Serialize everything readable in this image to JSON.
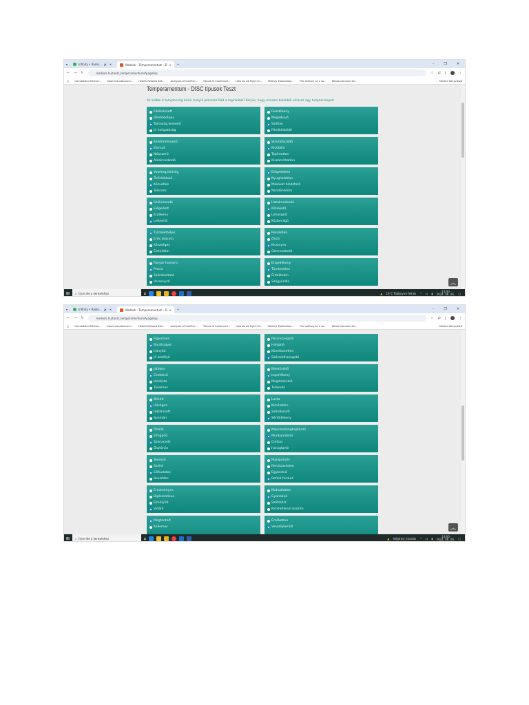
{
  "browser": {
    "tabs": [
      {
        "label": "Infinity • Radio...",
        "active": false
      },
      {
        "label": "Medock - Temperamentum - D",
        "active": true
      }
    ],
    "url": "medock.hu/teszt_temperamentum#pagetop",
    "bookmarks": [
      "Honvédelmi Miniszt...",
      "Good manufacturin...",
      "Health-Related Beh...",
      "Analyses of Confirm...",
      "Trends in Confirmed...",
      "How do we fight CO...",
      "Military Epidemiolo...",
      "The military as a so...",
      "Whole-Genome Se..."
    ],
    "all_bookmarks": "Minden könyvjelző"
  },
  "page": {
    "title": "Temperamentum - DISC típusok Teszt",
    "instruction": "Az alábbi 4 tulajdonság közül melyik jellemző Rád a leginkább? Kérjük, hogy minden blokkból válassz egy tulajdonságot!"
  },
  "taskbar": {
    "search_placeholder": "Írjon ide a kereséshez",
    "time": "14:00",
    "date": "2024. 06. 06."
  },
  "screens": [
    {
      "notification": "16°C Többnyire felhős",
      "rows": [
        [
          [
            [
              "Elkötelezett",
              0
            ],
            [
              "Döntésképes",
              0
            ],
            [
              "Társaság kedvelő",
              1
            ],
            [
              "Jó hallgatóság",
              0
            ]
          ],
          [
            [
              "Feledékeny",
              0
            ],
            [
              "Megalkuvó",
              0
            ],
            [
              "Szótlan",
              1
            ],
            [
              "Főnökösködő",
              0
            ]
          ]
        ],
        [
          [
            [
              "Kezdeményező",
              0
            ],
            [
              "Elemző",
              1
            ],
            [
              "Népszerű",
              0
            ],
            [
              "Alkalmazkodó",
              0
            ]
          ],
          [
            [
              "Visszahúzódó",
              0
            ],
            [
              "Kívülálló",
              1
            ],
            [
              "Tapintatlan",
              0
            ],
            [
              "Kiszámíthatlan",
              0
            ]
          ]
        ],
        [
          [
            [
              "Vezéregyéniség",
              0
            ],
            [
              "Önfeláldozó",
              0
            ],
            [
              "Közvetlen",
              1
            ],
            [
              "Toleráns",
              0
            ]
          ],
          [
            [
              "Elégedetlen",
              1
            ],
            [
              "Nyughatatlan",
              0
            ],
            [
              "Másokat hibáztató",
              0
            ],
            [
              "Nemtörődöm",
              0
            ]
          ]
        ],
        [
          [
            [
              "Szókimondó",
              0
            ],
            [
              "Elégedett",
              0
            ],
            [
              "Érzékeny",
              0
            ],
            [
              "Lelkesítő",
              1
            ]
          ],
          [
            [
              "Hatalmaskodó",
              0
            ],
            [
              "Kötekedő",
              1
            ],
            [
              "Lehangolt",
              0
            ],
            [
              "Közbevágó",
              0
            ]
          ]
        ],
        [
          [
            [
              "Tiszteletteljes",
              1
            ],
            [
              "Erős akaratú",
              0
            ],
            [
              "Készséges",
              0
            ],
            [
              "Életvidám",
              0
            ]
          ],
          [
            [
              "Rendetlen",
              0
            ],
            [
              "Önző",
              0
            ],
            [
              "Kicsinyes",
              1
            ],
            [
              "Gáncsoskodó",
              0
            ]
          ]
        ],
        [
          [
            [
              "Fanyar humorú",
              0
            ],
            [
              "Precíz",
              1
            ],
            [
              "Szórakoztató",
              0
            ],
            [
              "Versenyző",
              0
            ]
          ],
          [
            [
              "Engedékeny",
              0
            ],
            [
              "Türelmetlen",
              1
            ],
            [
              "Érdektelen",
              0
            ],
            [
              "Szégyenlős",
              0
            ]
          ]
        ]
      ]
    },
    {
      "notification": "Időjárási riasztás",
      "rows": [
        [
          [
            [
              "Figyelmes",
              0
            ],
            [
              "Barátságos",
              1
            ],
            [
              "Irányító",
              0
            ],
            [
              "Jó kedélyű",
              0
            ]
          ],
          [
            [
              "Parancsolgató",
              0
            ],
            [
              "Hallgató",
              0
            ],
            [
              "Következetlen",
              0
            ],
            [
              "Szőrszálhasogató",
              1
            ]
          ]
        ],
        [
          [
            [
              "Játékos",
              0
            ],
            [
              "Cselekvő",
              1
            ],
            [
              "Idealista",
              0
            ],
            [
              "Türelmes",
              0
            ]
          ],
          [
            [
              "Beletörődő",
              0
            ],
            [
              "Ingerlékeny",
              1
            ],
            [
              "Magánakvaló",
              0
            ],
            [
              "Tolakodó",
              0
            ]
          ]
        ],
        [
          [
            [
              "Békítő",
              0
            ],
            [
              "Hűséges",
              1
            ],
            [
              "Határozott",
              0
            ],
            [
              "Spontán",
              0
            ]
          ],
          [
            [
              "Lusta",
              0
            ],
            [
              "Kíméletlen",
              0
            ],
            [
              "Szórakozott",
              0
            ],
            [
              "Sértődékeny",
              1
            ]
          ]
        ],
        [
          [
            [
              "Önálló",
              0
            ],
            [
              "Elfogadó",
              0
            ],
            [
              "Szervezett",
              1
            ],
            [
              "Ösztönös",
              0
            ]
          ],
          [
            [
              "Népszerűséghajhászó",
              0
            ],
            [
              "Munkamániás",
              1
            ],
            [
              "Cinikus",
              0
            ],
            [
              "Haragtartó",
              0
            ]
          ]
        ],
        [
          [
            [
              "Tervező",
              0
            ],
            [
              "Szelíd",
              0
            ],
            [
              "Céltudatos",
              1
            ],
            [
              "Beszédes",
              0
            ]
          ],
          [
            [
              "Manipulatív",
              0
            ],
            [
              "Rendszertelen",
              0
            ],
            [
              "Egykedvű",
              0
            ],
            [
              "Befelé forduló",
              1
            ]
          ]
        ],
        [
          [
            [
              "Eredményes",
              0
            ],
            [
              "Diplomatikus",
              0
            ],
            [
              "Elmélyült",
              0
            ],
            [
              "Vidám",
              1
            ]
          ],
          [
            [
              "Motiválatlan",
              0
            ],
            [
              "Gyanakvó",
              1
            ],
            [
              "Szétszórt",
              0
            ],
            [
              "Kíméletlenül őszinte",
              0
            ]
          ]
        ],
        [
          [
            [
              "Megfontolt",
              1
            ],
            [
              "Kellemes",
              0
            ]
          ],
          [
            [
              "Érzéketlen",
              0
            ],
            [
              "Veszélykerülő",
              1
            ]
          ]
        ]
      ]
    }
  ]
}
